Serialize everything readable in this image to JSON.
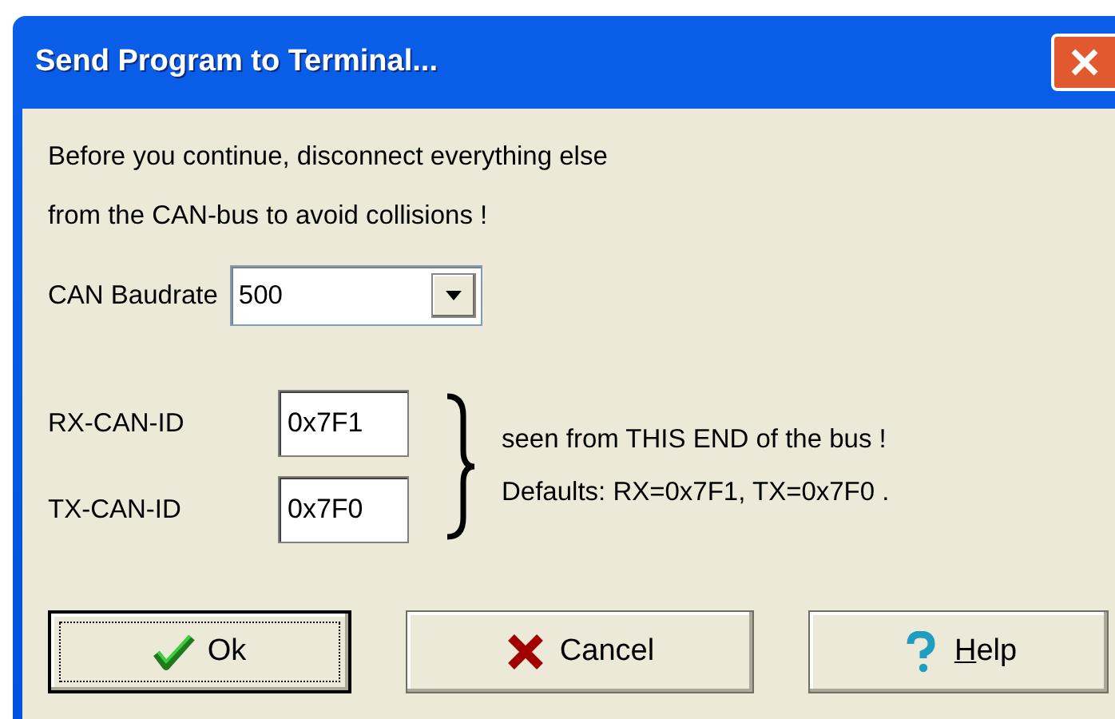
{
  "window": {
    "title": "Send Program to Terminal..."
  },
  "message_lines": [
    "Before you continue, disconnect everything else",
    "from the CAN-bus to avoid collisions !"
  ],
  "baudrate": {
    "label": "CAN Baudrate",
    "value": "500"
  },
  "ids": [
    {
      "label": "RX-CAN-ID",
      "value": "0x7F1"
    },
    {
      "label": "TX-CAN-ID",
      "value": "0x7F0"
    }
  ],
  "note_lines": [
    "seen from THIS END of the bus !",
    "Defaults: RX=0x7F1, TX=0x7F0 ."
  ],
  "buttons": [
    {
      "label": "Ok",
      "kind": "check",
      "default": true,
      "mnemonic": false
    },
    {
      "label": "Cancel",
      "kind": "cross",
      "default": false,
      "mnemonic": false
    },
    {
      "label": "Help",
      "kind": "help",
      "default": false,
      "mnemonic": true
    }
  ]
}
